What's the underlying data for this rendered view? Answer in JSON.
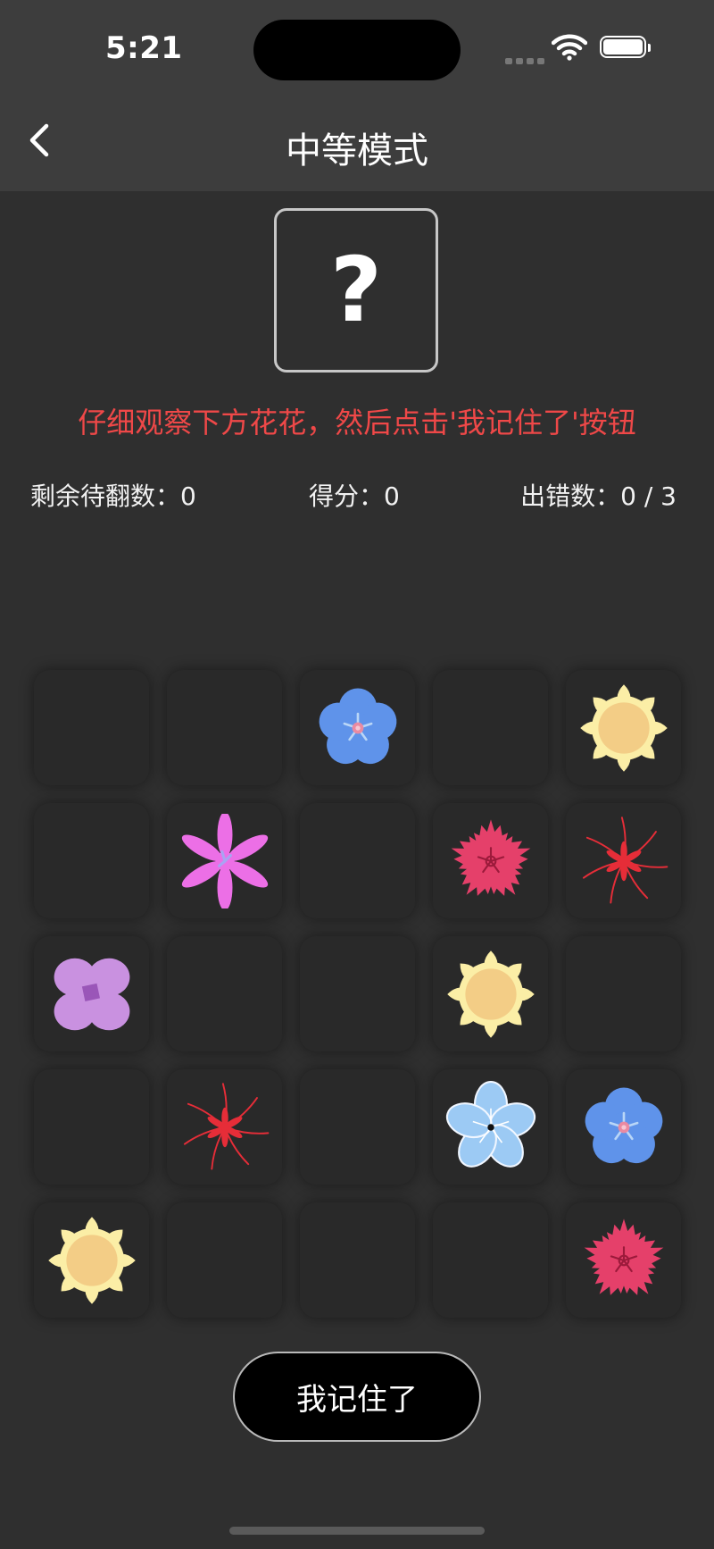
{
  "status_bar": {
    "time": "5:21"
  },
  "nav": {
    "title": "中等模式",
    "back_icon": "chevron-left-icon"
  },
  "question_card": {
    "symbol": "?"
  },
  "hint": "仔细观察下方花花，然后点击'我记住了'按钮",
  "stats": {
    "remaining": "剩余待翻数：0",
    "score": "得分：0",
    "errors": "出错数：0 / 3"
  },
  "grid": {
    "columns": 5,
    "rows": 5,
    "cells": [
      "",
      "",
      "forget-me-not",
      "",
      "yellow-daisy",
      "",
      "pink-star",
      "",
      "carnation",
      "red-spider-lily",
      "purple-hydrangea",
      "",
      "",
      "yellow-daisy",
      "",
      "",
      "red-spider-lily",
      "",
      "light-blue-flower",
      "forget-me-not",
      "yellow-daisy",
      "",
      "",
      "",
      "carnation"
    ]
  },
  "action": {
    "remember_label": "我记住了"
  },
  "colors": {
    "background": "#2f2f2f",
    "bar": "#3d3d3d",
    "cell": "#292929",
    "hint": "#ef4848"
  }
}
